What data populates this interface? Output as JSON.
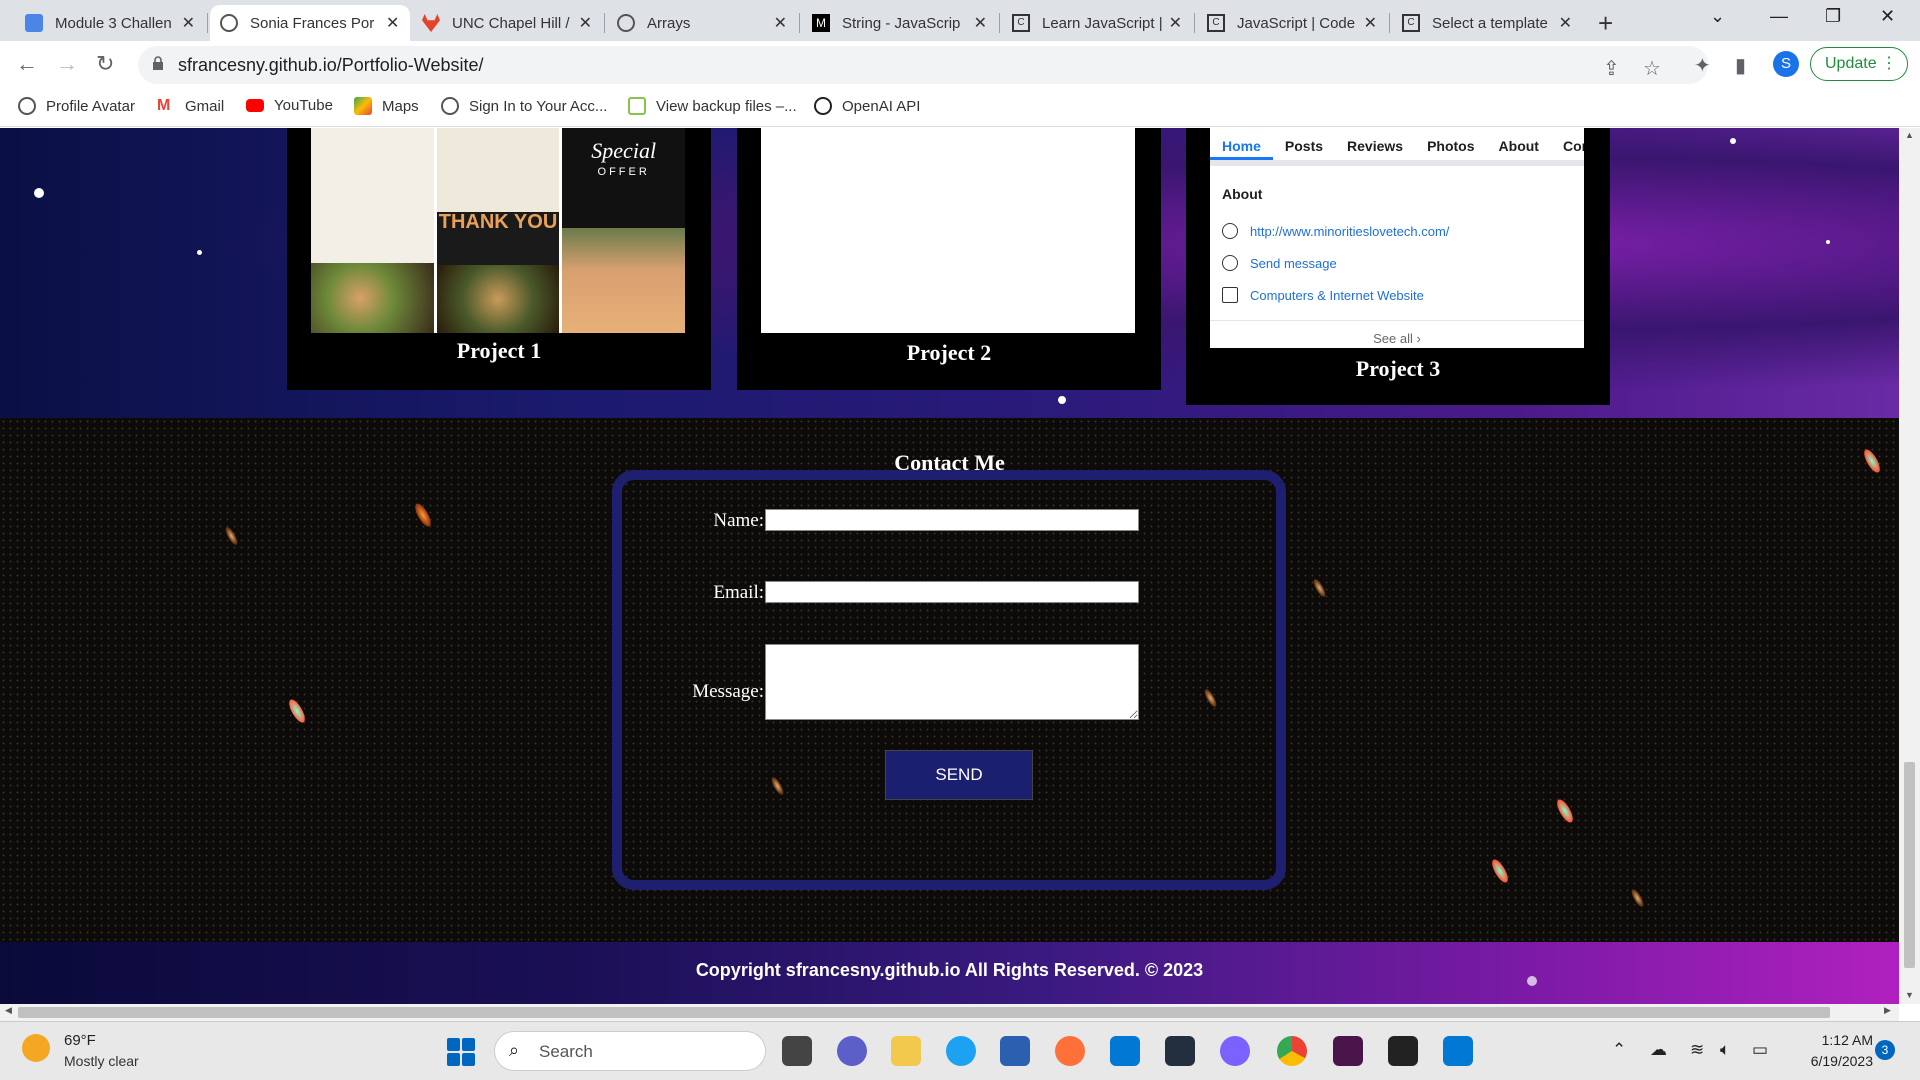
{
  "browser": {
    "tabs": [
      {
        "label": "Module 3 Challen",
        "active": false
      },
      {
        "label": "Sonia Frances Por",
        "active": true
      },
      {
        "label": "UNC Chapel Hill /",
        "active": false
      },
      {
        "label": "Arrays",
        "active": false
      },
      {
        "label": "String - JavaScrip",
        "active": false
      },
      {
        "label": "Learn JavaScript |",
        "active": false
      },
      {
        "label": "JavaScript | Code",
        "active": false
      },
      {
        "label": "Select a template",
        "active": false
      }
    ],
    "url": "sfrancesny.github.io/Portfolio-Website/",
    "profile_initial": "S",
    "update_label": "Update",
    "bookmarks": [
      "Profile Avatar",
      "Gmail",
      "YouTube",
      "Maps",
      "Sign In to Your Acc...",
      "View backup files –...",
      "OpenAI API"
    ]
  },
  "projects": [
    {
      "title": "Project 1"
    },
    {
      "title": "Project 2"
    },
    {
      "title": "Project 3",
      "fb_tabs": [
        "Home",
        "Posts",
        "Reviews",
        "Photos",
        "About",
        "Cor"
      ],
      "fb_about_heading": "About",
      "fb_link": "http://www.minoritieslovetech.com/",
      "fb_send": "Send message",
      "fb_category": "Computers & Internet Website",
      "fb_see_all": "See all"
    }
  ],
  "project1_image": {
    "thank_you": "THANK YOU",
    "special": "Special",
    "offer": "OFFER"
  },
  "contact": {
    "title": "Contact Me",
    "name_label": "Name:",
    "email_label": "Email:",
    "message_label": "Message:",
    "send_label": "SEND"
  },
  "footer": {
    "copyright": "Copyright sfrancesny.github.io All Rights Reserved. © 2023"
  },
  "taskbar": {
    "weather_temp": "69°F",
    "weather_desc": "Mostly clear",
    "search_label": "Search",
    "time": "1:12 AM",
    "date": "6/19/2023",
    "notifications": "3"
  }
}
